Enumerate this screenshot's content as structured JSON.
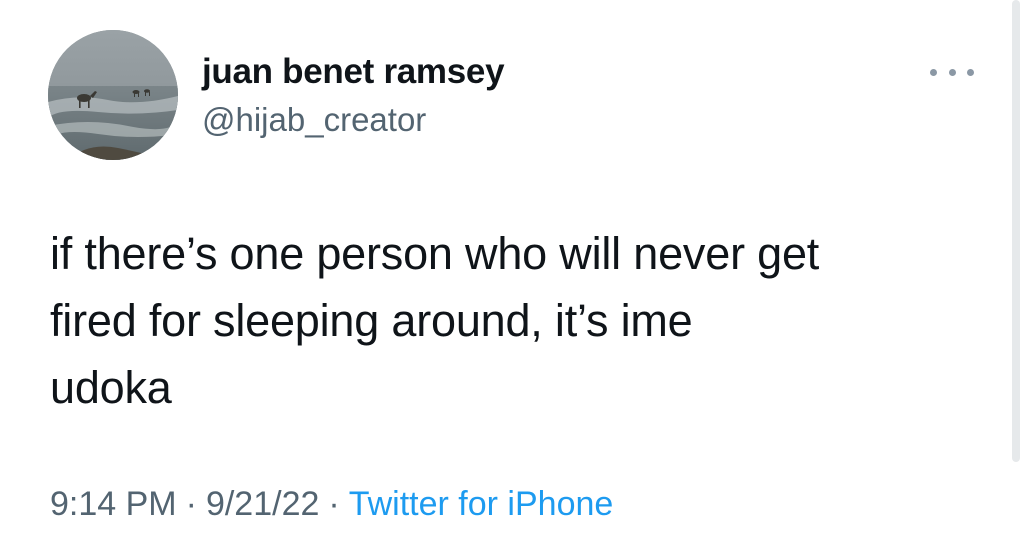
{
  "tweet": {
    "author": {
      "display_name": "juan benet ramsey",
      "handle": "@hijab_creator",
      "avatar_icon": "beach-camel-avatar"
    },
    "text": "if there’s one person who will never get\nfired for sleeping around, it’s ime\nudoka",
    "time": "9:14 PM",
    "date": "9/21/22",
    "separator": "·",
    "source": "Twitter for iPhone",
    "more_icon": "more-options-icon"
  },
  "colors": {
    "text_primary": "#0f1419",
    "text_secondary": "#536471",
    "link": "#1d9bf0"
  }
}
